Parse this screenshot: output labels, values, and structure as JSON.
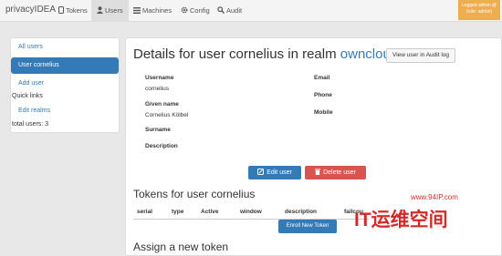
{
  "navbar": {
    "brand": "privacyIDEA",
    "items": [
      {
        "label": "Tokens"
      },
      {
        "label": "Users"
      },
      {
        "label": "Machines"
      },
      {
        "label": "Config"
      },
      {
        "label": "Audit"
      }
    ],
    "user_box": {
      "line1": "Logged admin @",
      "line2": "(role: admin)"
    }
  },
  "sidebar": {
    "all_users": "All users",
    "active_user": "User cornelius",
    "add_user": "Add user",
    "quick_links": "Quick links",
    "edit_realms": "Edit realms",
    "total": "total users: 3"
  },
  "details": {
    "title_prefix": "Details for user cornelius in realm",
    "realm": "owncloud",
    "audit_button": "View user in Audit log",
    "fields_left": [
      {
        "label": "Username",
        "value": "cornelius"
      },
      {
        "label": "Given name",
        "value": "Cornelius Kölbel"
      },
      {
        "label": "Surname",
        "value": ""
      },
      {
        "label": "Description",
        "value": ""
      }
    ],
    "fields_right": [
      {
        "label": "Email",
        "value": ""
      },
      {
        "label": "Phone",
        "value": ""
      },
      {
        "label": "Mobile",
        "value": ""
      }
    ],
    "edit_button": "Edit user",
    "delete_button": "Delete user"
  },
  "tokens": {
    "title": "Tokens for user cornelius",
    "columns": [
      "serial",
      "type",
      "Active",
      "window",
      "description",
      "failcou"
    ],
    "enroll_button": "Enroll New Token"
  },
  "assign": {
    "title": "Assign a new token"
  },
  "watermark": {
    "text": "IT运维空间",
    "url": "www.94IP.com"
  },
  "colors": {
    "primary": "#337ab7",
    "danger": "#d9534f",
    "warning": "#f0ad4e"
  }
}
